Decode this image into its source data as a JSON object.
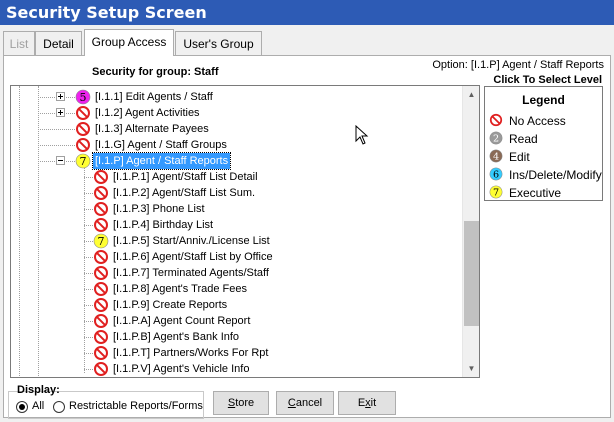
{
  "window": {
    "title": "Security Setup Screen"
  },
  "tabs": [
    {
      "label": "List",
      "disabled": true
    },
    {
      "label": "Detail",
      "disabled": false
    },
    {
      "label": "Group Access",
      "active": true
    },
    {
      "label": "User's Group",
      "disabled": false
    }
  ],
  "header": {
    "security_for_group": "Security for group: Staff",
    "option": "Option: [I.1.P] Agent / Staff Reports",
    "click_to_select": "Click To Select Level"
  },
  "tree": {
    "rows": [
      {
        "label": "[I.1.1] Edit Agents / Staff",
        "icon": "5"
      },
      {
        "label": "[I.1.2] Agent Activities",
        "icon": "no-access"
      },
      {
        "label": "[I.1.3] Alternate Payees",
        "icon": "no-access"
      },
      {
        "label": "[I.1.G] Agent / Staff Groups",
        "icon": "no-access"
      },
      {
        "label": "[I.1.P] Agent / Staff Reports",
        "icon": "7",
        "selected": true
      },
      {
        "label": "[I.1.P.1] Agent/Staff List Detail",
        "icon": "no-access"
      },
      {
        "label": "[I.1.P.2] Agent/Staff List Sum.",
        "icon": "no-access"
      },
      {
        "label": "[I.1.P.3] Phone List",
        "icon": "no-access"
      },
      {
        "label": "[I.1.P.4] Birthday List",
        "icon": "no-access"
      },
      {
        "label": "[I.1.P.5] Start/Anniv./License List",
        "icon": "7"
      },
      {
        "label": "[I.1.P.6] Agent/Staff List by Office",
        "icon": "no-access"
      },
      {
        "label": "[I.1.P.7] Terminated Agents/Staff",
        "icon": "no-access"
      },
      {
        "label": "[I.1.P.8] Agent's Trade Fees",
        "icon": "no-access"
      },
      {
        "label": "[I.1.P.9] Create Reports",
        "icon": "no-access"
      },
      {
        "label": "[I.1.P.A] Agent Count Report",
        "icon": "no-access"
      },
      {
        "label": "[I.1.P.B] Agent's Bank Info",
        "icon": "no-access"
      },
      {
        "label": "[I.1.P.T] Partners/Works For Rpt",
        "icon": "no-access"
      },
      {
        "label": "[I.1.P.V] Agent's Vehicle Info",
        "icon": "no-access"
      }
    ]
  },
  "legend": {
    "title": "Legend",
    "items": [
      {
        "label": "No Access",
        "icon": "no-access"
      },
      {
        "label": "Read",
        "icon": "2"
      },
      {
        "label": "Edit",
        "icon": "4"
      },
      {
        "label": "Ins/Delete/Modify",
        "icon": "6"
      },
      {
        "label": "Executive",
        "icon": "7"
      }
    ]
  },
  "display": {
    "label": "Display:",
    "options": [
      {
        "label": "All",
        "checked": true
      },
      {
        "label": "Restrictable Reports/Forms",
        "checked": false
      }
    ]
  },
  "buttons": {
    "store": {
      "pre": "",
      "accel": "S",
      "post": "tore"
    },
    "cancel": {
      "pre": "",
      "accel": "C",
      "post": "ancel"
    },
    "exit": {
      "pre": "E",
      "accel": "x",
      "post": "it"
    }
  },
  "colors": {
    "titlebar": "#2d5bb5",
    "selection": "#3399ff",
    "no_access_red": "#e02020",
    "level_2": "#9a9a9a",
    "level_4": "#8a6a55",
    "level_5": "#ee22ee",
    "level_6": "#33ccff",
    "level_7": "#ffff33"
  }
}
